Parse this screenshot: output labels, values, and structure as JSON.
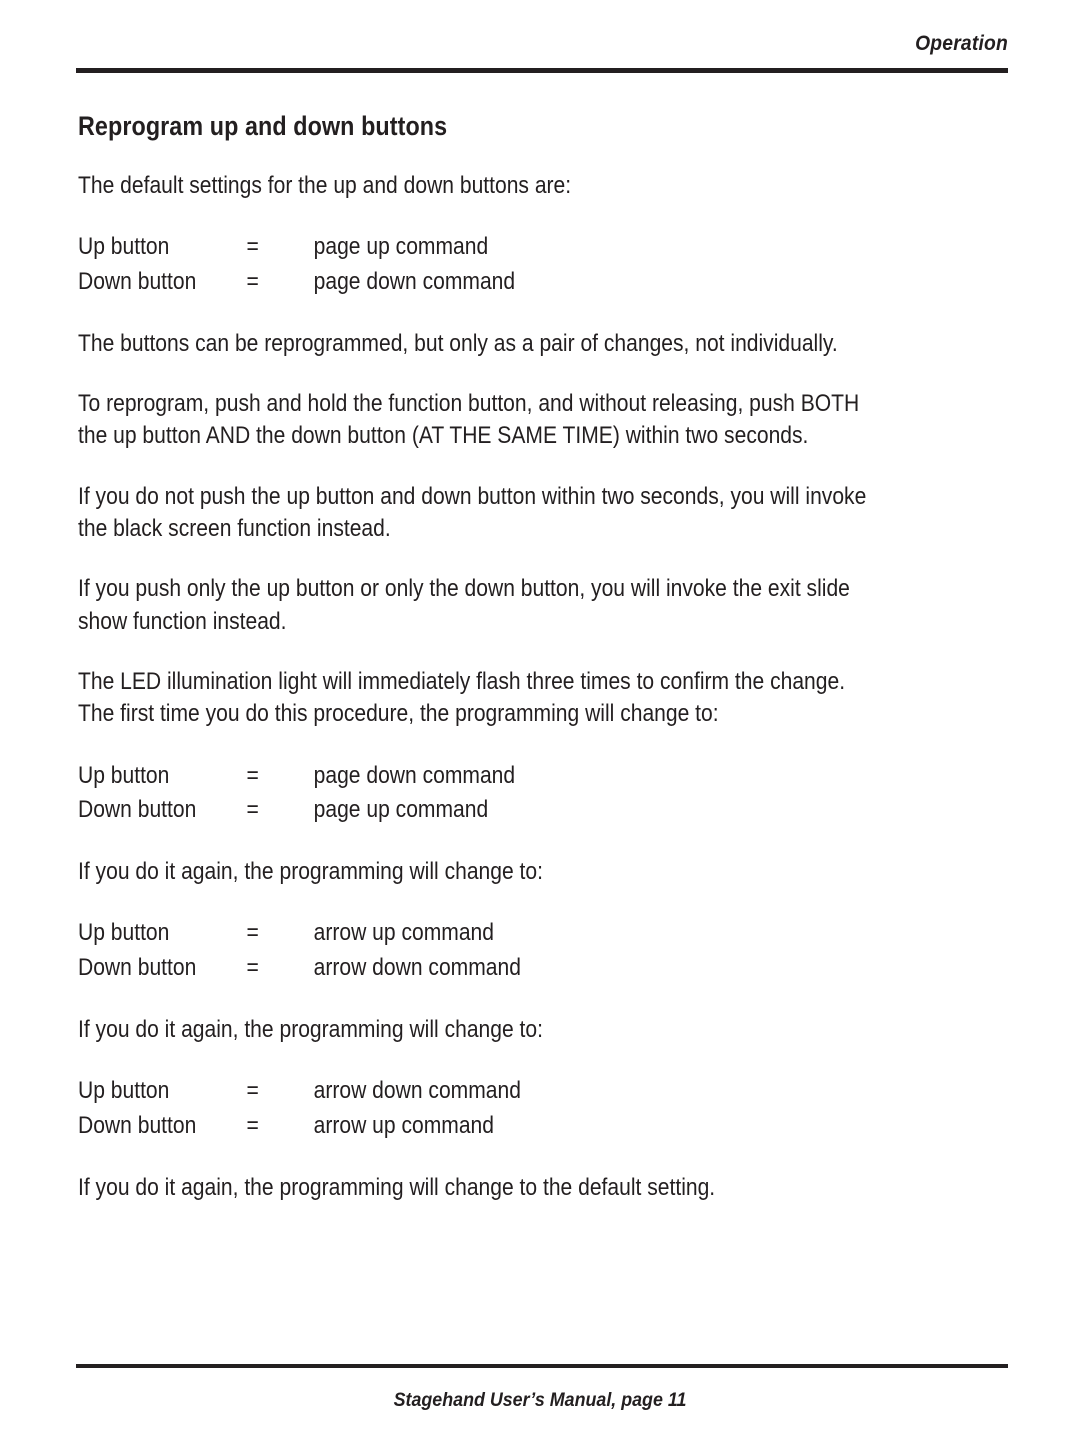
{
  "page": {
    "running_head": "Operation",
    "footer": "Stagehand User’s Manual, page 11",
    "text_color": "#231f20",
    "background_color": "#ffffff"
  },
  "heading": "Reprogram up and down buttons",
  "paragraphs": {
    "intro": "The default settings for the up and down buttons are:",
    "pair_note": "The buttons can be reprogrammed, but only as a pair of changes, not individually.",
    "reprogram_line1": "To reprogram, push and hold the function button, and without releasing, push BOTH",
    "reprogram_line2": "the up button AND the down button (AT THE SAME TIME) within two seconds.",
    "black_screen_line1": "If you do not push the up button and down button within two seconds, you will invoke",
    "black_screen_line2": "the black screen function instead.",
    "exit_slide_line1": "If you push only the up button or only the down button, you will invoke the exit slide",
    "exit_slide_line2": "show function instead.",
    "led_line1": "The LED illumination light will immediately flash three times to confirm the change.",
    "led_line2": "The first time you do this procedure, the programming will change to:",
    "again_1": "If you do it again, the programming will change to:",
    "again_2": "If you do it again, the programming will change to:",
    "again_default": "If you do it again, the programming will change to the default setting."
  },
  "settings": {
    "default": {
      "up_label": "Up button",
      "up_eq": "=",
      "up_value": "page up command",
      "down_label": "Down button",
      "down_eq": "=",
      "down_value": "page down command"
    },
    "first_change": {
      "up_label": "Up button",
      "up_eq": "=",
      "up_value": "page down command",
      "down_label": "Down button",
      "down_eq": "=",
      "down_value": "page up command"
    },
    "second_change": {
      "up_label": "Up button",
      "up_eq": "=",
      "up_value": "arrow up command",
      "down_label": "Down button",
      "down_eq": "=",
      "down_value": "arrow down command"
    },
    "third_change": {
      "up_label": "Up button",
      "up_eq": "=",
      "up_value": "arrow down command",
      "down_label": "Down button",
      "down_eq": "=",
      "down_value": "arrow up command"
    }
  }
}
